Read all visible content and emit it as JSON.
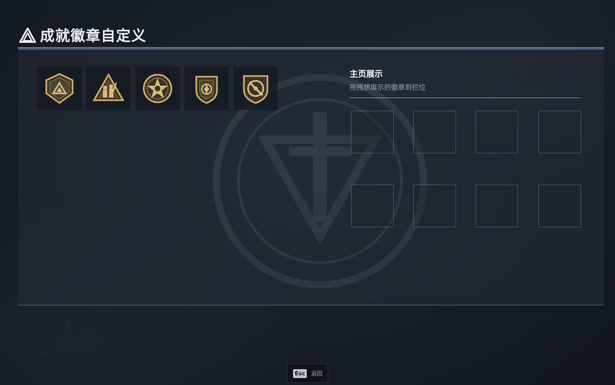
{
  "header": {
    "title": "成就徽章自定义",
    "logo_icon": "triangle-logo-icon"
  },
  "badges": [
    {
      "icon": "shield-triangle-badge-icon"
    },
    {
      "icon": "triangle-soldiers-badge-icon"
    },
    {
      "icon": "star-circle-badge-icon"
    },
    {
      "icon": "shield-emblem-badge-icon"
    },
    {
      "icon": "shield-slash-badge-icon"
    }
  ],
  "showcase": {
    "heading": "主页展示",
    "subtitle": "拖拽想展示的徽章到栏位",
    "slots": 8
  },
  "footer": {
    "key": "Esc",
    "label": "返回"
  },
  "colors": {
    "badge_gold": "#c9a86a",
    "badge_dark": "#3a3426",
    "panel": "#262e38",
    "accent_line": "#5e6e7e"
  }
}
